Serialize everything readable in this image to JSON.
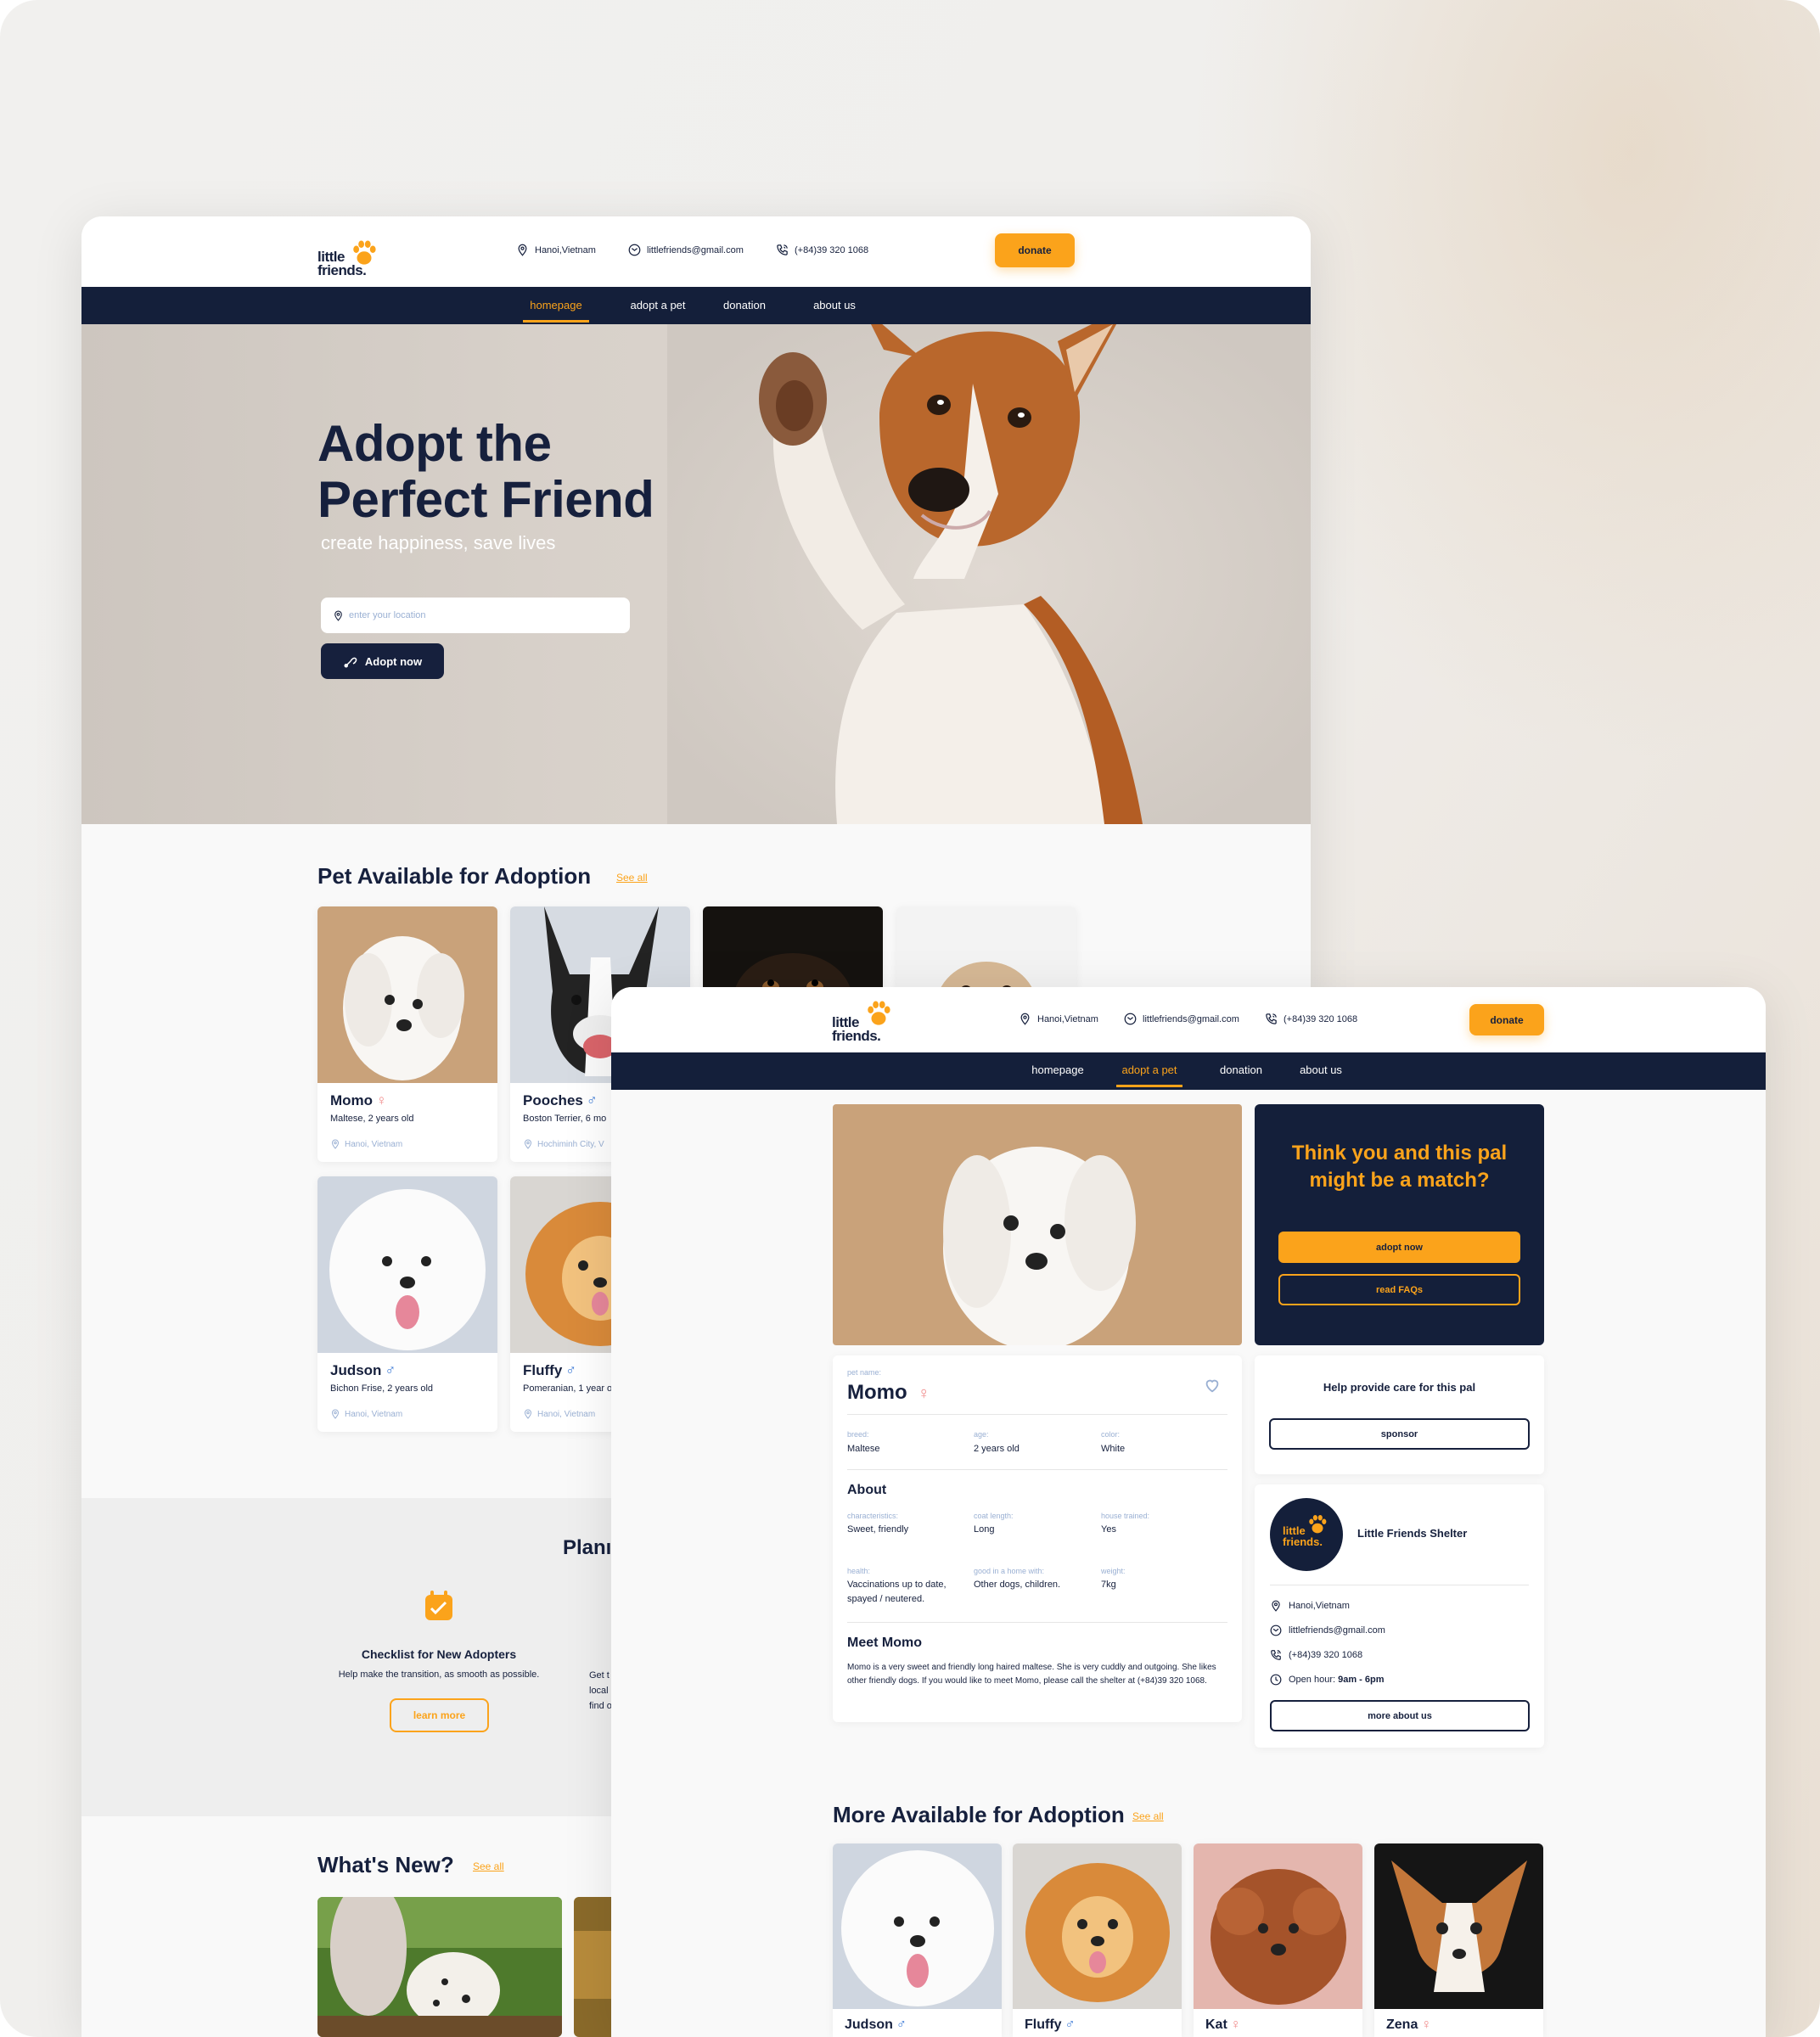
{
  "brand": {
    "name_line1": "little",
    "name_line2": "friends.",
    "accent": "#fba31b",
    "navy": "#141f3a"
  },
  "header": {
    "location": "Hanoi,Vietnam",
    "email": "littlefriends@gmail.com",
    "phone": "(+84)39 320 1068",
    "donate_label": "donate"
  },
  "nav": {
    "items": [
      "homepage",
      "adopt a pet",
      "donation",
      "about us"
    ],
    "active_home": "homepage",
    "active_detail": "adopt a pet"
  },
  "hero": {
    "title_line1": "Adopt the",
    "title_line2": "Perfect Friend",
    "subtitle": "create happiness, save lives",
    "location_placeholder": "enter your location",
    "adopt_label": "Adopt now"
  },
  "adoption": {
    "title": "Pet Available for Adoption",
    "see_all": "See all",
    "pets": [
      {
        "name": "Momo",
        "sex": "♀",
        "breed": "Maltese, 2 years old",
        "location": "Hanoi, Vietnam"
      },
      {
        "name": "Pooches",
        "sex": "♂",
        "breed": "Boston Terrier, 6 mo",
        "location": "Hochiminh City, V"
      },
      {
        "name": "Judson",
        "sex": "♂",
        "breed": "Bichon Frise, 2 years old",
        "location": "Hanoi, Vietnam"
      },
      {
        "name": "Fluffy",
        "sex": "♂",
        "breed": "Pomeranian, 1 year o",
        "location": "Hanoi, Vietnam"
      }
    ]
  },
  "planning": {
    "title": "Planı",
    "item_title": "Checklist for New Adopters",
    "item_desc": "Help make the transition, as smooth as possible.",
    "item_btn": "learn more",
    "cut_text_1": "Get t",
    "cut_text_2": "local s",
    "cut_text_3": "find o"
  },
  "news": {
    "title": "What's New?",
    "see_all": "See all"
  },
  "detail": {
    "pet_name_label": "pet name:",
    "pet_name": "Momo",
    "pet_sex": "♀",
    "fields": [
      {
        "label": "breed:",
        "value": "Maltese"
      },
      {
        "label": "age:",
        "value": "2 years old"
      },
      {
        "label": "color:",
        "value": "White"
      }
    ],
    "about_title": "About",
    "about_fields": [
      {
        "label": "characteristics:",
        "value": "Sweet, friendly"
      },
      {
        "label": "coat length:",
        "value": "Long"
      },
      {
        "label": "house trained:",
        "value": "Yes"
      },
      {
        "label": "health:",
        "value": "Vaccinations up to date, spayed / neutered."
      },
      {
        "label": "good in a home with:",
        "value": "Other dogs, children."
      },
      {
        "label": "weight:",
        "value": "7kg"
      }
    ],
    "meet_title": "Meet Momo",
    "meet_text": "Momo is a very sweet and friendly long haired maltese. She is very cuddly and outgoing. She likes other friendly dogs. If you would like to meet Momo, please call the shelter at (+84)39 320 1068."
  },
  "match": {
    "question_line1": "Think you and this pal",
    "question_line2": "might be a match?",
    "adopt_label": "adopt now",
    "faq_label": "read FAQs"
  },
  "sponsor": {
    "title": "Help provide care for this pal",
    "btn": "sponsor"
  },
  "shelter": {
    "name": "Little Friends Shelter",
    "location": "Hanoi,Vietnam",
    "email": "littlefriends@gmail.com",
    "phone": "(+84)39 320 1068",
    "hours_label": "Open hour:",
    "hours_value": "9am - 6pm",
    "btn": "more about us"
  },
  "more": {
    "title": "More Available for Adoption",
    "see_all": "See all",
    "pets": [
      {
        "name": "Judson",
        "sex": "♂"
      },
      {
        "name": "Fluffy",
        "sex": "♂"
      },
      {
        "name": "Kat",
        "sex": "♀"
      },
      {
        "name": "Zena",
        "sex": "♀"
      }
    ]
  }
}
